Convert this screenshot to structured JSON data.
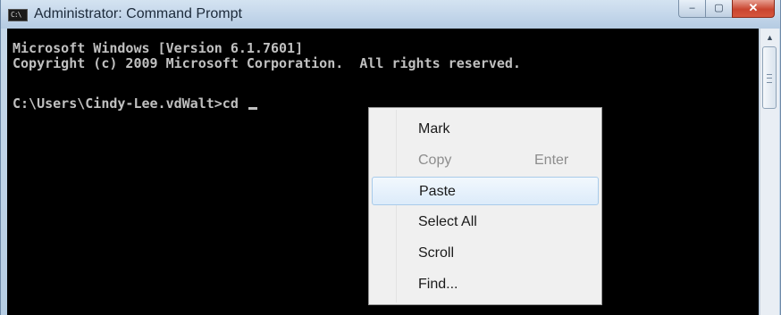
{
  "window": {
    "title": "Administrator: Command Prompt",
    "icon_text": "C:\\",
    "controls": {
      "minimize": "–",
      "maximize": "▢",
      "close": "✕"
    }
  },
  "console": {
    "lines": [
      "Microsoft Windows [Version 6.1.7601]",
      "Copyright (c) 2009 Microsoft Corporation.  All rights reserved.",
      "",
      "C:\\Users\\Cindy-Lee.vdWalt>cd "
    ]
  },
  "scrollbar": {
    "up_arrow": "▲"
  },
  "context_menu": {
    "items": [
      {
        "label": "Mark",
        "shortcut": "",
        "enabled": true,
        "highlighted": false
      },
      {
        "label": "Copy",
        "shortcut": "Enter",
        "enabled": false,
        "highlighted": false
      },
      {
        "label": "Paste",
        "shortcut": "",
        "enabled": true,
        "highlighted": true
      },
      {
        "label": "Select All",
        "shortcut": "",
        "enabled": true,
        "highlighted": false
      },
      {
        "label": "Scroll",
        "shortcut": "",
        "enabled": true,
        "highlighted": false
      },
      {
        "label": "Find...",
        "shortcut": "",
        "enabled": true,
        "highlighted": false
      }
    ]
  },
  "colors": {
    "console_bg": "#000000",
    "console_text": "#c0c0c0",
    "menu_bg": "#f0f0f0",
    "menu_highlight": "#dcebfa",
    "close_button": "#c9452f"
  }
}
